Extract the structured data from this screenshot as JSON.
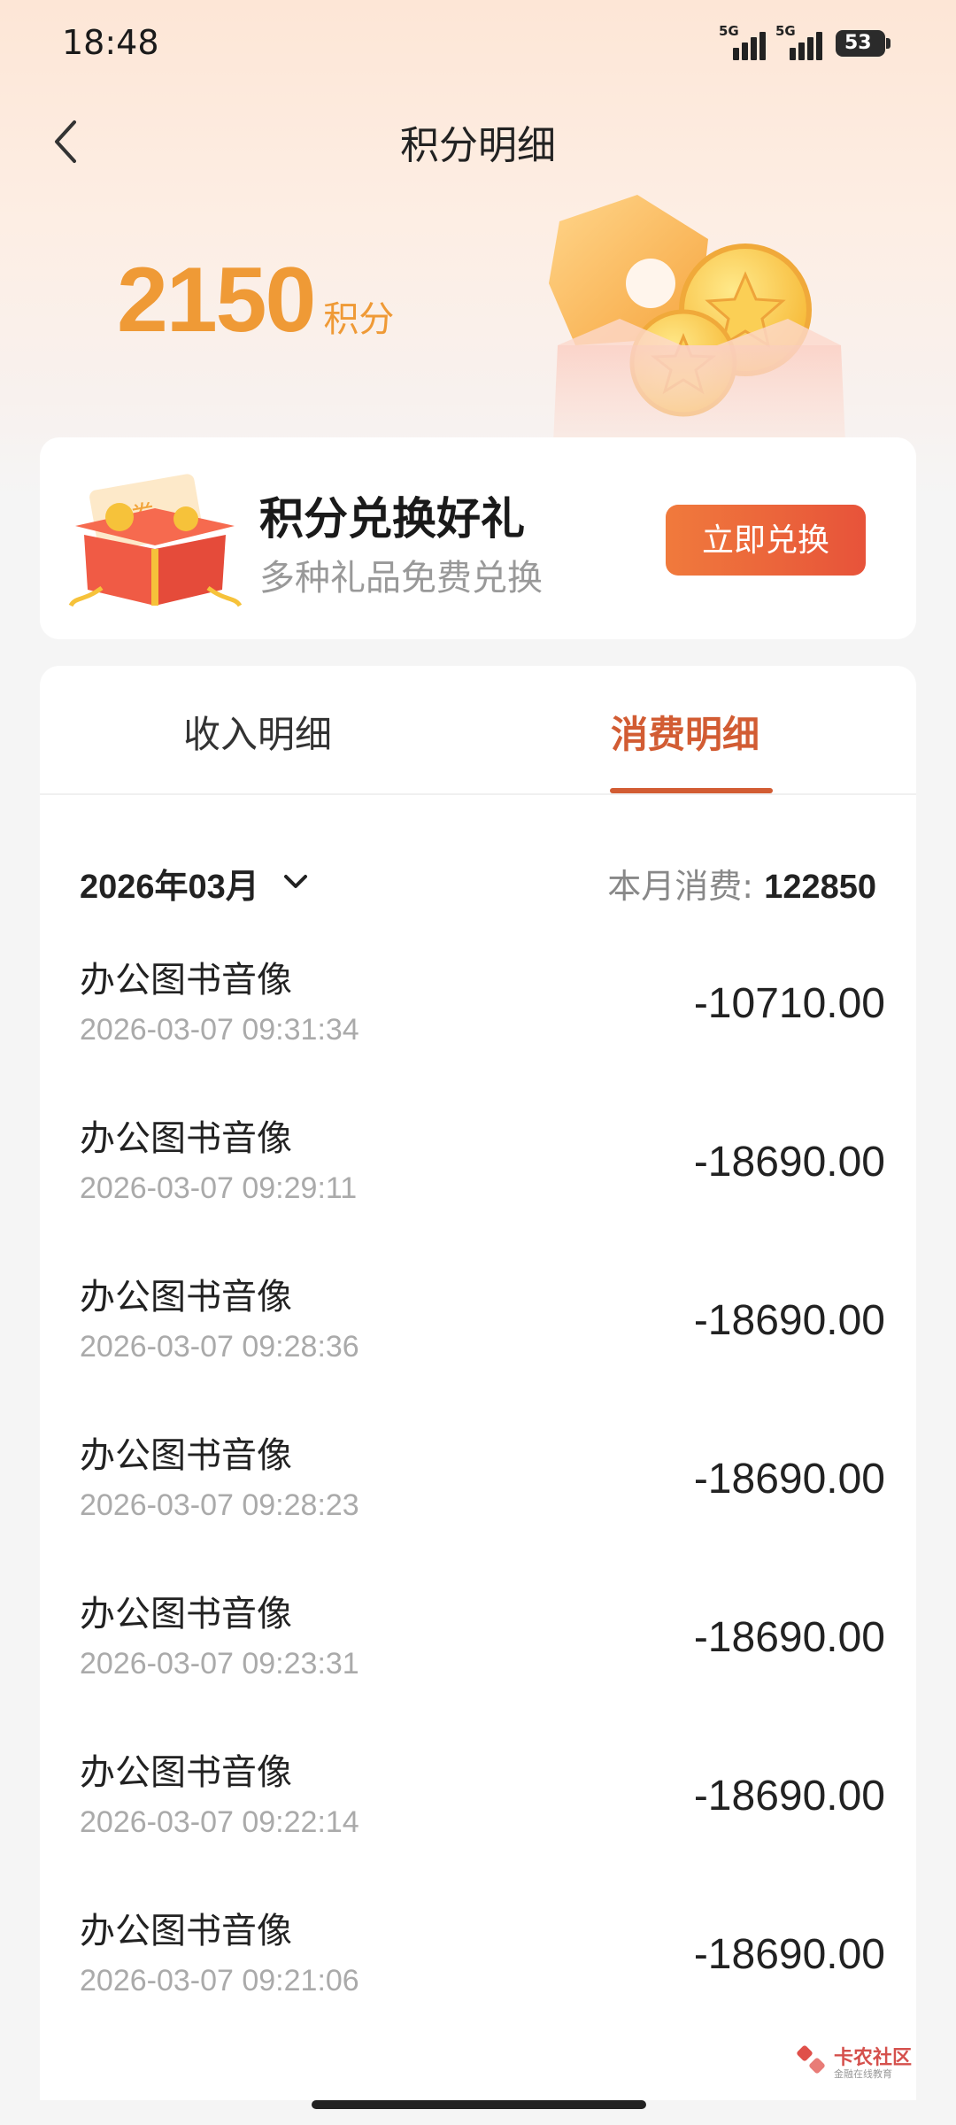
{
  "status_bar": {
    "time": "18:48",
    "signal1": "5G",
    "signal2": "5G",
    "battery": "53"
  },
  "header": {
    "title": "积分明细"
  },
  "points": {
    "value": "2150",
    "unit": "积分"
  },
  "promo": {
    "title": "积分兑换好礼",
    "subtitle": "多种礼品免费兑换",
    "button": "立即兑换",
    "gift_label": "券"
  },
  "tabs": [
    {
      "label": "收入明细",
      "active": false
    },
    {
      "label": "消费明细",
      "active": true
    }
  ],
  "filter": {
    "month": "2026年03月",
    "total_label": "本月消费:",
    "total_value": "122850"
  },
  "records": [
    {
      "name": "办公图书音像",
      "time": "2026-03-07 09:31:34",
      "amount": "-10710.00"
    },
    {
      "name": "办公图书音像",
      "time": "2026-03-07 09:29:11",
      "amount": "-18690.00"
    },
    {
      "name": "办公图书音像",
      "time": "2026-03-07 09:28:36",
      "amount": "-18690.00"
    },
    {
      "name": "办公图书音像",
      "time": "2026-03-07 09:28:23",
      "amount": "-18690.00"
    },
    {
      "name": "办公图书音像",
      "time": "2026-03-07 09:23:31",
      "amount": "-18690.00"
    },
    {
      "name": "办公图书音像",
      "time": "2026-03-07 09:22:14",
      "amount": "-18690.00"
    },
    {
      "name": "办公图书音像",
      "time": "2026-03-07 09:21:06",
      "amount": "-18690.00"
    }
  ],
  "watermark": {
    "title": "卡农社区",
    "subtitle": "金融在线教育"
  },
  "colors": {
    "accent": "#d25c33",
    "points": "#ef9a36",
    "button_start": "#f07a3c",
    "button_end": "#e7533a"
  }
}
